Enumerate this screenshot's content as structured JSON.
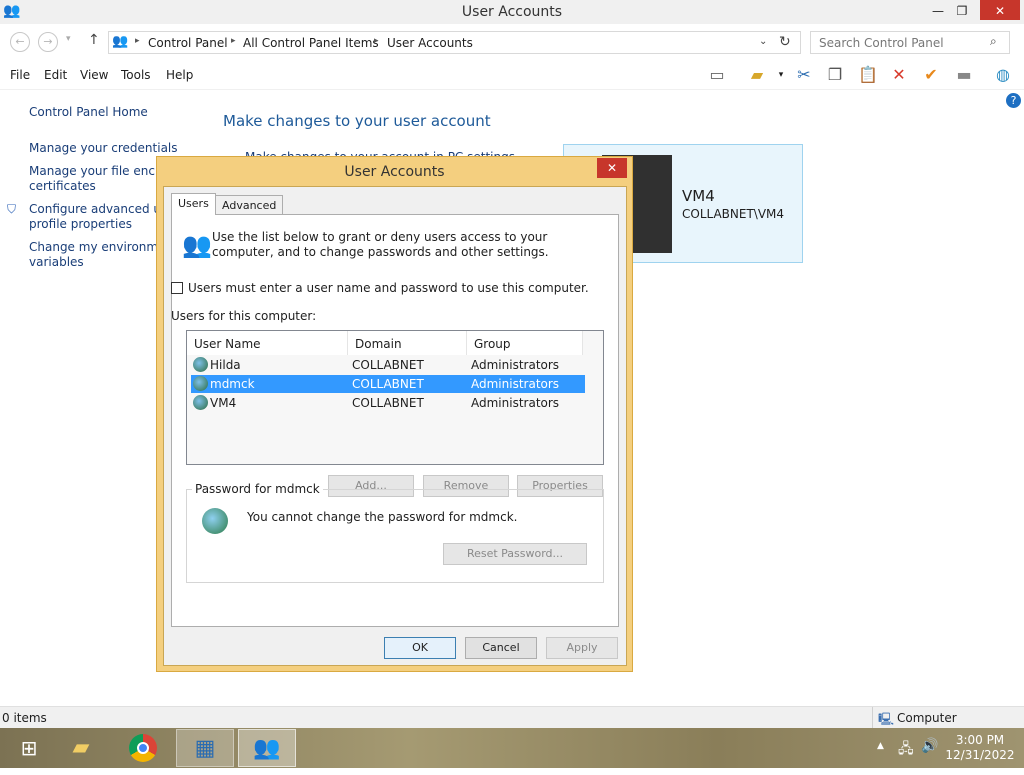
{
  "window": {
    "title": "User Accounts",
    "minimize": "—",
    "maximize": "❐",
    "close": "✕"
  },
  "address": {
    "crumbs": [
      "Control Panel",
      "All Control Panel Items",
      "User Accounts"
    ],
    "search_placeholder": "Search Control Panel"
  },
  "menu": {
    "items": [
      "File",
      "Edit",
      "View",
      "Tools",
      "Help"
    ]
  },
  "toolbar": {
    "icons": [
      "layout-icon",
      "folder-check-icon",
      "cut-icon",
      "copy-icon",
      "paste-icon",
      "delete-icon",
      "check-icon",
      "properties-icon",
      "globe-icon"
    ]
  },
  "left_pane": {
    "home": "Control Panel Home",
    "links": [
      "Manage your credentials",
      "Manage your file encryp",
      "certificates",
      "Configure advanced use",
      "profile properties",
      "Change my environment",
      "variables"
    ]
  },
  "main": {
    "title": "Make changes to your user account",
    "partial": "Make changes to your account in PC settings"
  },
  "account_card": {
    "name": "VM4",
    "domain": "COLLABNET\\VM4"
  },
  "dialog": {
    "title": "User Accounts",
    "tabs": [
      "Users",
      "Advanced"
    ],
    "intro": "Use the list below to grant or deny users access to your computer, and to change passwords and other settings.",
    "must_login_label": "Users must enter a user name and password to use this computer.",
    "must_login_checked": false,
    "users_label": "Users for this computer:",
    "columns": [
      "User Name",
      "Domain",
      "Group"
    ],
    "users": [
      {
        "name": "Hilda",
        "domain": "COLLABNET",
        "group": "Administrators"
      },
      {
        "name": "mdmck",
        "domain": "COLLABNET",
        "group": "Administrators"
      },
      {
        "name": "VM4",
        "domain": "COLLABNET",
        "group": "Administrators"
      }
    ],
    "selected_user": "mdmck",
    "buttons": {
      "add": "Add...",
      "remove": "Remove",
      "properties": "Properties",
      "reset": "Reset Password...",
      "ok": "OK",
      "cancel": "Cancel",
      "apply": "Apply"
    },
    "password_group_title": "Password for mdmck",
    "password_message": "You cannot change the password for mdmck."
  },
  "status": {
    "items": "0 items",
    "zone": "Computer"
  },
  "taskbar": {
    "time": "3:00 PM",
    "date": "12/31/2022"
  },
  "colors": {
    "selection": "#3399ff",
    "dialog_frame": "#f4cf7f",
    "close_red": "#c7362b"
  }
}
